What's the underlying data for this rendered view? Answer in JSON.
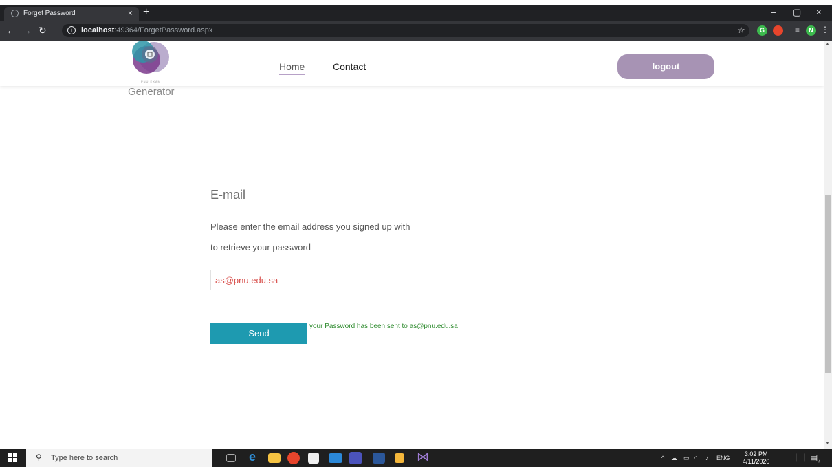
{
  "browser": {
    "tab_title": "Forget Password",
    "tab_close": "×",
    "new_tab": "+",
    "minimize": "–",
    "maximize": "▢",
    "close": "×",
    "url_host": "localhost",
    "url_path": ":49364/ForgetPassword.aspx",
    "ext_g": "G",
    "ext_n": "N"
  },
  "header": {
    "logo_text": "Generator",
    "logo_small": "PNU EXAM",
    "nav_home": "Home",
    "nav_contact": "Contact",
    "logout": "logout"
  },
  "form": {
    "title": "E-mail",
    "instruction_line1": "Please enter the email address you signed up with",
    "instruction_line2": "to retrieve your password",
    "email_value": "as@pnu.edu.sa",
    "send_label": "Send",
    "success_message": "your Password has been sent to as@pnu.edu.sa"
  },
  "taskbar": {
    "search_placeholder": "Type here to search",
    "tray_lang": "ENG",
    "time": "3:02 PM",
    "date": "4/11/2020",
    "notification_count": "7"
  },
  "colors": {
    "logout_bg": "#a793b4",
    "send_bg": "#1e9ab0",
    "email_text": "#d9534f",
    "success_text": "#2e8b2e"
  }
}
